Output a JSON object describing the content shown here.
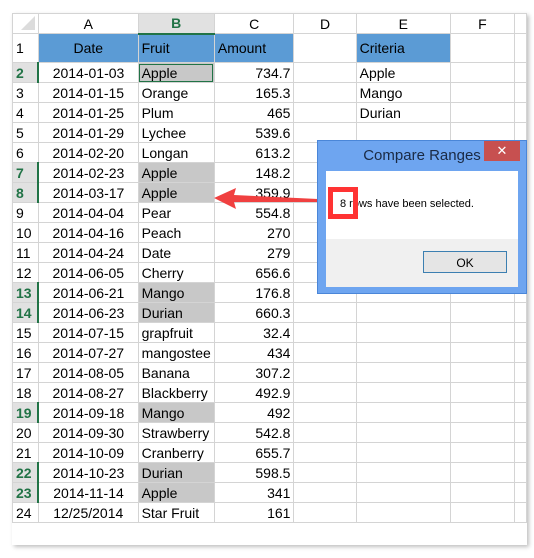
{
  "columns": [
    "A",
    "B",
    "C",
    "D",
    "E",
    "F"
  ],
  "selected_column": "B",
  "header_row": {
    "row": 1,
    "date": "Date",
    "fruit": "Fruit",
    "amount": "Amount",
    "criteria": "Criteria"
  },
  "criteria": [
    "Apple",
    "Mango",
    "Durian"
  ],
  "rows": [
    {
      "row": 2,
      "date": "2014-01-03",
      "fruit": "Apple",
      "amount": "734.7",
      "selected": true,
      "active": true
    },
    {
      "row": 3,
      "date": "2014-01-15",
      "fruit": "Orange",
      "amount": "165.3",
      "selected": false
    },
    {
      "row": 4,
      "date": "2014-01-25",
      "fruit": "Plum",
      "amount": "465",
      "selected": false
    },
    {
      "row": 5,
      "date": "2014-01-29",
      "fruit": "Lychee",
      "amount": "539.6",
      "selected": false
    },
    {
      "row": 6,
      "date": "2014-02-20",
      "fruit": "Longan",
      "amount": "613.2",
      "selected": false
    },
    {
      "row": 7,
      "date": "2014-02-23",
      "fruit": "Apple",
      "amount": "148.2",
      "selected": true
    },
    {
      "row": 8,
      "date": "2014-03-17",
      "fruit": "Apple",
      "amount": "359.9",
      "selected": true
    },
    {
      "row": 9,
      "date": "2014-04-04",
      "fruit": "Pear",
      "amount": "554.8",
      "selected": false
    },
    {
      "row": 10,
      "date": "2014-04-16",
      "fruit": "Peach",
      "amount": "270",
      "selected": false
    },
    {
      "row": 11,
      "date": "2014-04-24",
      "fruit": "Date",
      "amount": "279",
      "selected": false
    },
    {
      "row": 12,
      "date": "2014-06-05",
      "fruit": "Cherry",
      "amount": "656.6",
      "selected": false
    },
    {
      "row": 13,
      "date": "2014-06-21",
      "fruit": "Mango",
      "amount": "176.8",
      "selected": true
    },
    {
      "row": 14,
      "date": "2014-06-23",
      "fruit": "Durian",
      "amount": "660.3",
      "selected": true
    },
    {
      "row": 15,
      "date": "2014-07-15",
      "fruit": "grapfruit",
      "amount": "32.4",
      "selected": false
    },
    {
      "row": 16,
      "date": "2014-07-27",
      "fruit": "mangostee",
      "amount": "434",
      "selected": false
    },
    {
      "row": 17,
      "date": "2014-08-05",
      "fruit": "Banana",
      "amount": "307.2",
      "selected": false
    },
    {
      "row": 18,
      "date": "2014-08-27",
      "fruit": "Blackberry",
      "amount": "492.9",
      "selected": false
    },
    {
      "row": 19,
      "date": "2014-09-18",
      "fruit": "Mango",
      "amount": "492",
      "selected": true
    },
    {
      "row": 20,
      "date": "2014-09-30",
      "fruit": "Strawberry",
      "amount": "542.8",
      "selected": false
    },
    {
      "row": 21,
      "date": "2014-10-09",
      "fruit": "Cranberry",
      "amount": "655.7",
      "selected": false
    },
    {
      "row": 22,
      "date": "2014-10-23",
      "fruit": "Durian",
      "amount": "598.5",
      "selected": true
    },
    {
      "row": 23,
      "date": "2014-11-14",
      "fruit": "Apple",
      "amount": "341",
      "selected": true
    },
    {
      "row": 24,
      "date": "12/25/2014",
      "fruit": "Star Fruit",
      "amount": "161",
      "selected": false
    }
  ],
  "dialog": {
    "title": "Compare Ranges",
    "close_glyph": "✕",
    "message": "8 rows have been selected.",
    "ok_label": "OK"
  },
  "colors": {
    "header_fill": "#5b9bd5",
    "highlight_fill": "#c8c8c8",
    "selection_green": "#217346",
    "callout_red": "#ff3333"
  }
}
